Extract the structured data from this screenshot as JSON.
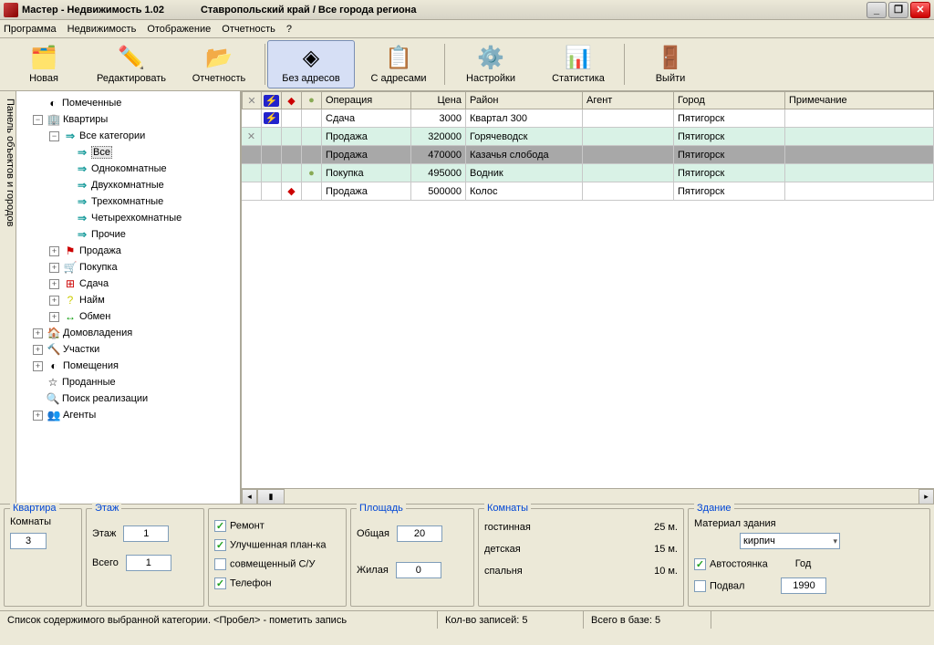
{
  "window": {
    "title1": "Мастер - Недвижимость 1.02",
    "title2": "Ставропольский край / Все города региона"
  },
  "menu": {
    "program": "Программа",
    "realty": "Недвижимость",
    "display": "Отображение",
    "reports": "Отчетность",
    "help": "?"
  },
  "toolbar": {
    "new": "Новая",
    "edit": "Редактировать",
    "report": "Отчетность",
    "noaddr": "Без адресов",
    "withaddr": "С адресами",
    "settings": "Настройки",
    "stats": "Статистика",
    "exit": "Выйти"
  },
  "sidetab": "Панель объектов и городов",
  "tree": {
    "marked": "Помеченные",
    "apartments": "Квартиры",
    "allcat": "Все категории",
    "all": "Все",
    "one": "Однокомнатные",
    "two": "Двухкомнатные",
    "three": "Трехкомнатные",
    "four": "Четырехкомнатные",
    "other": "Прочие",
    "sale": "Продажа",
    "buy": "Покупка",
    "rent": "Сдача",
    "hire": "Найм",
    "exchange": "Обмен",
    "houses": "Домовладения",
    "land": "Участки",
    "premises": "Помещения",
    "sold": "Проданные",
    "search": "Поиск реализации",
    "agents": "Агенты"
  },
  "grid": {
    "headers": {
      "op": "Операция",
      "price": "Цена",
      "district": "Район",
      "agent": "Агент",
      "city": "Город",
      "note": "Примечание"
    },
    "rows": [
      {
        "mark": "⚡",
        "op": "Сдача",
        "price": "3000",
        "district": "Квартал 300",
        "agent": "",
        "city": "Пятигорск",
        "note": ""
      },
      {
        "pre": "✕",
        "op": "Продажа",
        "price": "320000",
        "district": "Горячеводск",
        "agent": "",
        "city": "Пятигорск",
        "note": ""
      },
      {
        "op": "Продажа",
        "price": "470000",
        "district": "Казачья слобода",
        "agent": "",
        "city": "Пятигорск",
        "note": ""
      },
      {
        "ball": "●",
        "op": "Покупка",
        "price": "495000",
        "district": "Водник",
        "agent": "",
        "city": "Пятигорск",
        "note": ""
      },
      {
        "red": "◆",
        "op": "Продажа",
        "price": "500000",
        "district": "Колос",
        "agent": "",
        "city": "Пятигорск",
        "note": ""
      }
    ]
  },
  "panel": {
    "apartment": "Квартира",
    "rooms_lbl": "Комнаты",
    "rooms_val": "3",
    "floor_title": "Этаж",
    "floor_lbl": "Этаж",
    "floor_val": "1",
    "total_lbl": "Всего",
    "total_val": "1",
    "chk_repair": "Ремонт",
    "chk_plan": "Улучшенная план-ка",
    "chk_wc": "совмещенный С/У",
    "chk_phone": "Телефон",
    "area_title": "Площадь",
    "area_total_lbl": "Общая",
    "area_total_val": "20",
    "area_live_lbl": "Жилая",
    "area_live_val": "0",
    "rooms2_title": "Комнаты",
    "room1_n": "гостинная",
    "room1_v": "25 м.",
    "room2_n": "детская",
    "room2_v": "15 м.",
    "room3_n": "спальня",
    "room3_v": "10 м.",
    "building_title": "Здание",
    "material_lbl": "Материал здания",
    "material_val": "кирпич",
    "parking": "Автостоянка",
    "basement": "Подвал",
    "year_lbl": "Год",
    "year_val": "1990"
  },
  "status": {
    "hint": "Список содержимого выбранной категории. <Пробел> - пометить запись",
    "count": "Кол-во записей: 5",
    "base": "Всего в базе: 5"
  }
}
